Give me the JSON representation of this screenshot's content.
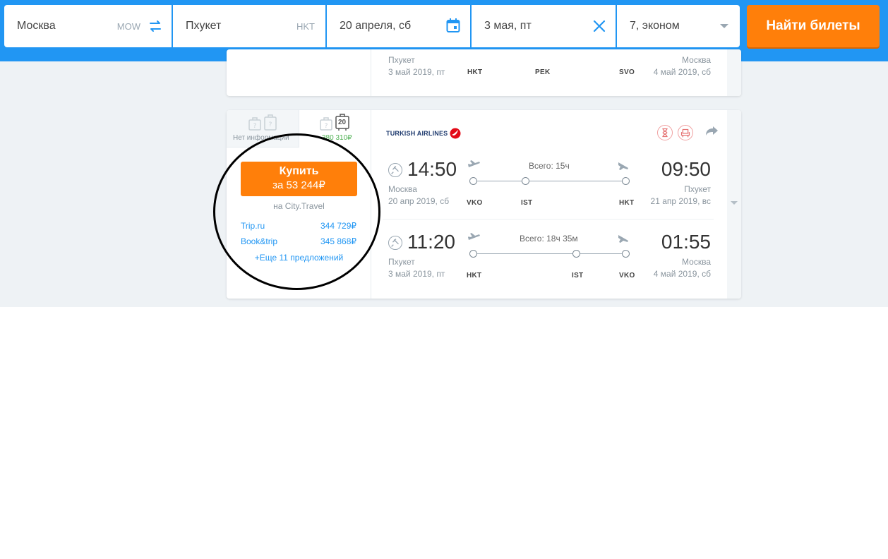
{
  "search": {
    "from": {
      "city": "Москва",
      "code": "MOW"
    },
    "to": {
      "city": "Пхукет",
      "code": "HKT"
    },
    "depart_date": "20 апреля, сб",
    "return_date": "3 мая, пт",
    "passengers": "7, эконом",
    "submit_label": "Найти билеты"
  },
  "prev_card": {
    "from_city": "Пхукет",
    "from_date": "3 май 2019, пт",
    "to_city": "Москва",
    "to_date": "4 май 2019, сб",
    "codes": [
      "HKT",
      "PEK",
      "SVO"
    ]
  },
  "ticket": {
    "baggage_tab1_caption": "Нет информации",
    "baggage_tab2_badge": "20",
    "baggage_tab2_price": "380 310₽",
    "buy_label": "Купить",
    "buy_price": "за 53 244₽",
    "agent": "на City.Travel",
    "offers": [
      {
        "name": "Trip.ru",
        "price": "344 729₽"
      },
      {
        "name": "Book&trip",
        "price": "345 868₽"
      }
    ],
    "more_offers": "+Еще 11 предложений",
    "airline": "TURKISH AIRLINES",
    "segments": [
      {
        "dep_time": "14:50",
        "dep_city": "Москва",
        "dep_date": "20 апр 2019, сб",
        "arr_time": "09:50",
        "arr_city": "Пхукет",
        "arr_date": "21 апр 2019, вс",
        "duration": "Всего: 15ч",
        "codes": [
          "VKO",
          "IST",
          "HKT"
        ]
      },
      {
        "dep_time": "11:20",
        "dep_city": "Пхукет",
        "dep_date": "3 май 2019, пт",
        "arr_time": "01:55",
        "arr_city": "Москва",
        "arr_date": "4 май 2019, сб",
        "duration": "Всего: 18ч 35м",
        "codes": [
          "HKT",
          "IST",
          "VKO"
        ]
      }
    ]
  },
  "colors": {
    "header": "#2196f3",
    "accent": "#ff7f0a",
    "link": "#2196f3",
    "price_green": "#4caf50"
  }
}
